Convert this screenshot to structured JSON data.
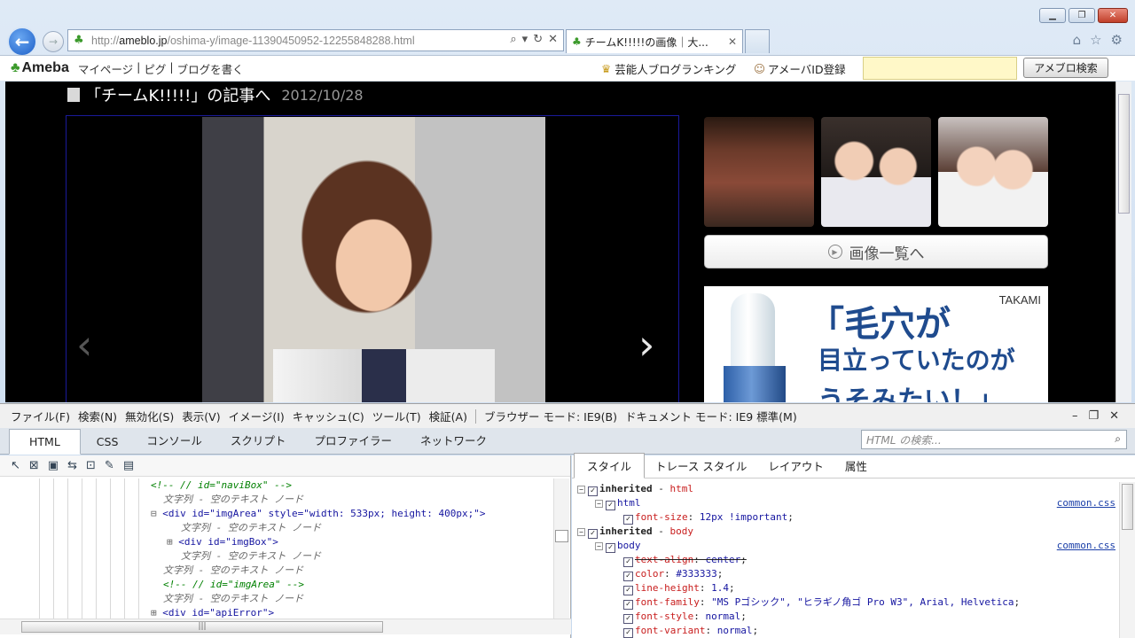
{
  "browser": {
    "url_prefix": "http://",
    "url_host": "ameblo.jp",
    "url_path": "/oshima-y/image-11390450952-12255848288.html",
    "tab_title": "チームK!!!!!の画像｜大...",
    "tab_close": "✕",
    "window_min": "▁",
    "window_max": "❐",
    "window_close": "✕",
    "toolbar_icons": [
      "home-icon",
      "star-icon",
      "gear-icon"
    ]
  },
  "ameba_bar": {
    "logo": "Ameba",
    "links": [
      "マイページ",
      "|",
      "ピグ",
      "|",
      "ブログを書く"
    ],
    "ranking": "芸能人ブログランキング",
    "register": "アメーバID登録",
    "search_value": "",
    "search_button": "アメブロ検索"
  },
  "page": {
    "article_link": "「チームK!!!!!」の記事へ",
    "date": "2012/10/28",
    "prev_arrow": "‹",
    "next_arrow": "›",
    "image_list_button": "画像一覧へ",
    "ad": {
      "brand": "TAKAMI",
      "line1": "「毛穴が",
      "line2": "目立っていたのが",
      "line3": "うそみたい！」"
    }
  },
  "devtools": {
    "menu": [
      "ファイル(F)",
      "検索(N)",
      "無効化(S)",
      "表示(V)",
      "イメージ(I)",
      "キャッシュ(C)",
      "ツール(T)",
      "検証(A)"
    ],
    "browser_mode": "ブラウザー モード: IE9(B)",
    "document_mode": "ドキュメント モード: IE9 標準(M)",
    "tabs": [
      "HTML",
      "CSS",
      "コンソール",
      "スクリプト",
      "プロファイラー",
      "ネットワーク"
    ],
    "active_tab": "HTML",
    "html_search_placeholder": "HTML の検索...",
    "tree": [
      {
        "indent": 170,
        "kind": "comment",
        "text": "<!--  // id=\"naviBox\" -->"
      },
      {
        "indent": 184,
        "kind": "text",
        "text": "文字列 - 空のテキスト ノード"
      },
      {
        "indent": 170,
        "kind": "tag",
        "prefix": "⊟ ",
        "text": "<div id=\"imgArea\" style=\"width: 533px; height: 400px;\">"
      },
      {
        "indent": 204,
        "kind": "text",
        "text": "文字列 - 空のテキスト ノード"
      },
      {
        "indent": 188,
        "kind": "tag",
        "prefix": "⊞ ",
        "text": "<div id=\"imgBox\">"
      },
      {
        "indent": 204,
        "kind": "text",
        "text": "文字列 - 空のテキスト ノード"
      },
      {
        "indent": 184,
        "kind": "text",
        "text": "文字列 - 空のテキスト ノード"
      },
      {
        "indent": 184,
        "kind": "comment",
        "text": "<!--  // id=\"imgArea\" -->"
      },
      {
        "indent": 184,
        "kind": "text",
        "text": "文字列 - 空のテキスト ノード"
      },
      {
        "indent": 170,
        "kind": "tag",
        "prefix": "⊞ ",
        "text": "<div id=\"apiError\">"
      }
    ],
    "style_tabs": [
      "スタイル",
      "トレース スタイル",
      "レイアウト",
      "属性"
    ],
    "active_style_tab": "スタイル",
    "rules": {
      "inherited_html": "inherited",
      "inherited_html_sep": " - ",
      "inherited_html_el": "html",
      "html_selector": "html",
      "html_source": "common.css",
      "html_prop": "font-size",
      "html_val": "12px !important",
      "inherited_body": "inherited",
      "inherited_body_sep": " - ",
      "inherited_body_el": "body",
      "body_selector": "body",
      "body_source": "common.css",
      "props": [
        {
          "name": "text-align",
          "value": "center",
          "struck": true
        },
        {
          "name": "color",
          "value": "#333333",
          "struck": false
        },
        {
          "name": "line-height",
          "value": "1.4",
          "struck": false
        },
        {
          "name": "font-family",
          "value": "\"MS Pゴシック\", \"ヒラギノ角ゴ Pro W3\", Arial, Helvetica",
          "struck": false
        },
        {
          "name": "font-style",
          "value": "normal",
          "struck": false
        },
        {
          "name": "font-variant",
          "value": "normal",
          "struck": false
        }
      ]
    }
  }
}
